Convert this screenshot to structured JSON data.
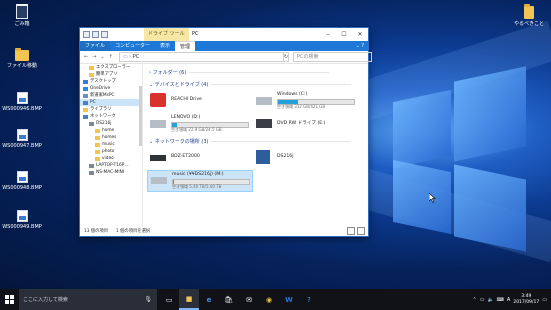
{
  "desktop": {
    "icons_left": [
      {
        "label": "ごみ箱",
        "icon": "recycle-bin-icon"
      },
      {
        "label": "ファイル移動",
        "icon": "folder-icon"
      },
      {
        "label": "WS000946.BMP",
        "icon": "bmp-file-icon"
      },
      {
        "label": "WS000947.BMP",
        "icon": "bmp-file-icon"
      },
      {
        "label": "WS000948.BMP",
        "icon": "bmp-file-icon"
      },
      {
        "label": "WS000949.BMP",
        "icon": "bmp-file-icon"
      }
    ],
    "icon_right": {
      "label": "やるべきこと",
      "icon": "folder-icon"
    }
  },
  "explorer": {
    "title": "PC",
    "tool_tab": "ドライブ ツール",
    "ribbon_tabs": [
      "ファイル",
      "コンピューター",
      "表示",
      "管理"
    ],
    "address": "PC",
    "search_placeholder": "PCの検索",
    "nav": [
      {
        "label": "エクスプローラー",
        "indent": 1,
        "color": "#f2c452"
      },
      {
        "label": "簡単アプリ",
        "indent": 1,
        "color": "#f2c452"
      },
      {
        "label": "デスクトップ",
        "indent": 0,
        "color": "#3b7bd6"
      },
      {
        "label": "OneDrive",
        "indent": 0,
        "color": "#2b88d8"
      },
      {
        "label": "新道家MsPC",
        "indent": 0,
        "color": "#6e8fb8"
      },
      {
        "label": "PC",
        "indent": 0,
        "color": "#4a7fc1",
        "selected": true
      },
      {
        "label": "ライブラリ",
        "indent": 0,
        "color": "#f2c452"
      },
      {
        "label": "ネットワーク",
        "indent": 0,
        "color": "#4a7fc1"
      },
      {
        "label": "DS216j",
        "indent": 1,
        "color": "#7a8796"
      },
      {
        "label": "home",
        "indent": 2,
        "color": "#f2c452"
      },
      {
        "label": "homes",
        "indent": 2,
        "color": "#f2c452"
      },
      {
        "label": "music",
        "indent": 2,
        "color": "#f2c452"
      },
      {
        "label": "photo",
        "indent": 2,
        "color": "#f2c452"
      },
      {
        "label": "video",
        "indent": 2,
        "color": "#f2c452"
      },
      {
        "label": "LAPTOP-T16P…",
        "indent": 1,
        "color": "#7a8796"
      },
      {
        "label": "NS-MAC-MINI",
        "indent": 1,
        "color": "#7a8796"
      }
    ],
    "groups": {
      "folders": "フォルダー (6)",
      "devices": "デバイスとドライブ (4)",
      "network": "ネットワークの場所 (3)"
    },
    "drives": [
      {
        "name": "REACHI Drive",
        "icon": "app-drive-icon"
      },
      {
        "name": "Windows (C:)",
        "free": "空き領域 312 GB/421 GB",
        "used": 0.26,
        "icon": "windows-drive-icon"
      },
      {
        "name": "LENOVO (D:)",
        "free": "空き領域 22.9 GB/24.5 GB",
        "used": 0.07,
        "icon": "hdd-icon"
      },
      {
        "name": "DVD RW ドライブ (E:)",
        "icon": "dvd-drive-icon"
      }
    ],
    "network_locations": [
      {
        "name": "BDZ-ET2000",
        "icon": "recorder-icon"
      },
      {
        "name": "DS216j",
        "icon": "nas-icon"
      },
      {
        "name": "music (¥¥DS216j) (M:)",
        "free": "空き領域 5.40 TB/5.40 TB",
        "used": 0.01,
        "icon": "network-drive-icon",
        "selected": true
      }
    ],
    "status": {
      "count": "13 個の項目",
      "selected": "1 個の項目を選択"
    }
  },
  "taskbar": {
    "search_placeholder": "ここに入力して検索",
    "apps": [
      "file-explorer-icon",
      "edge-icon",
      "store-icon",
      "mail-icon",
      "chrome-icon",
      "word-icon",
      "help-icon"
    ],
    "ime": "A",
    "time": "3:49",
    "date": "2017/09/17"
  }
}
